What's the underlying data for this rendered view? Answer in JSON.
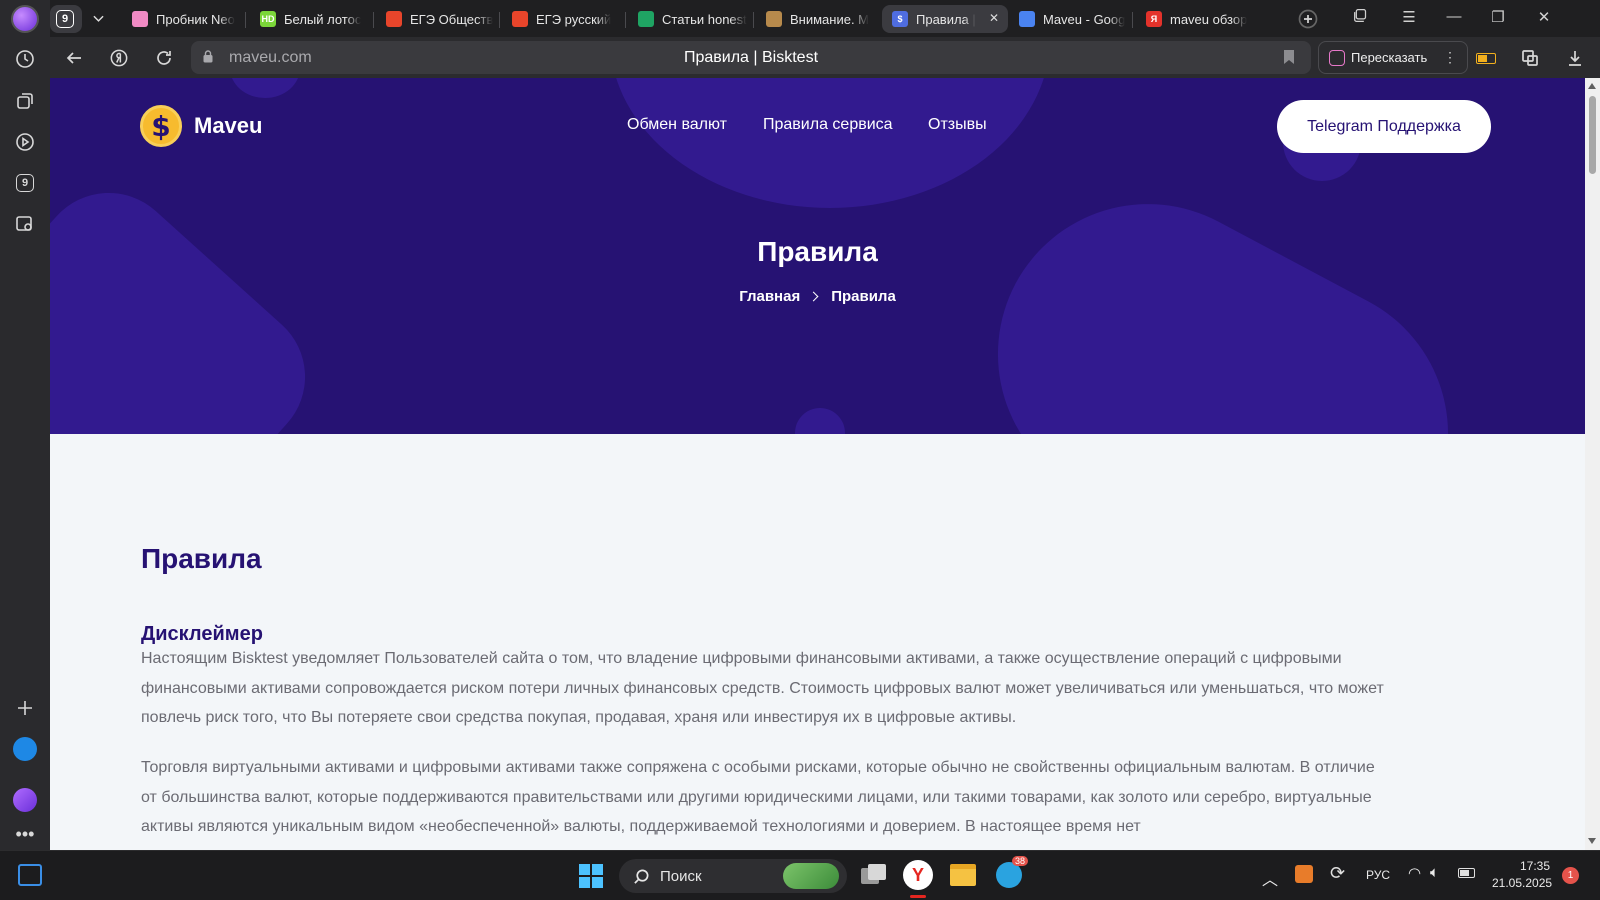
{
  "browser": {
    "tab_count_badge": "9",
    "tabs": [
      {
        "title": "Пробник Neo",
        "fav_color": "#f08ac4",
        "fav_text": "",
        "active": false
      },
      {
        "title": "Белый лотос",
        "fav_color": "#7bd639",
        "fav_text": "HD",
        "active": false
      },
      {
        "title": "ЕГЭ Обществ",
        "fav_color": "#e8452b",
        "fav_text": "",
        "active": false
      },
      {
        "title": "ЕГЭ русский",
        "fav_color": "#e8452b",
        "fav_text": "",
        "active": false
      },
      {
        "title": "Статьи honest",
        "fav_color": "#1fa463",
        "fav_text": "",
        "active": false
      },
      {
        "title": "Внимание. М",
        "fav_color": "#b78a4c",
        "fav_text": "",
        "active": false
      },
      {
        "title": "Правила |",
        "fav_color": "#4f6de0",
        "fav_text": "$",
        "active": true
      },
      {
        "title": "Maveu - Goog",
        "fav_color": "#4a83f0",
        "fav_text": "",
        "active": false
      },
      {
        "title": "maveu обзор",
        "fav_color": "#e3322b",
        "fav_text": "Я",
        "active": false
      }
    ],
    "address": {
      "domain": "maveu.com",
      "page_title": "Правила | Bisktest"
    },
    "retell_label": "Пересказать"
  },
  "site": {
    "logo_glyph": "$",
    "logo_name": "Maveu",
    "nav": [
      "Обмен валют",
      "Правила сервиса",
      "Отзывы"
    ],
    "support_button": "Telegram Поддержка",
    "hero_title": "Правила",
    "breadcrumb": {
      "home": "Главная",
      "current": "Правила"
    }
  },
  "content": {
    "heading": "Правила",
    "section_heading": "Дисклеймер",
    "paragraph_1": "Настоящим Bisktest уведомляет Пользователей сайта о том, что владение цифровыми финансовыми активами, а также осуществление операций с цифровыми финансовыми активами сопровождается риском потери личных финансовых средств. Стоимость цифровых валют может увеличиваться или уменьшаться, что может повлечь риск того, что Вы потеряете свои средства покупая, продавая, храня или инвестируя их в цифровые активы.",
    "paragraph_2": "Торговля виртуальными активами и цифровыми активами также сопряжена с особыми рисками, которые обычно не свойственны официальным валютам. В отличие от большинства валют, которые поддерживаются правительствами или другими юридическими лицами, или такими товарами, как золото или серебро, виртуальные активы являются уникальным видом «необеспеченной» валюты, поддерживаемой технологиями и доверием. В настоящее время нет"
  },
  "taskbar": {
    "search_label": "Поиск",
    "telegram_badge": "38",
    "language": "РУС",
    "time": "17:35",
    "date": "21.05.2025",
    "notification_count": "1"
  },
  "colors": {
    "hero_bg": "#261273",
    "accent": "#261273",
    "coin": "#f7bb2e"
  }
}
